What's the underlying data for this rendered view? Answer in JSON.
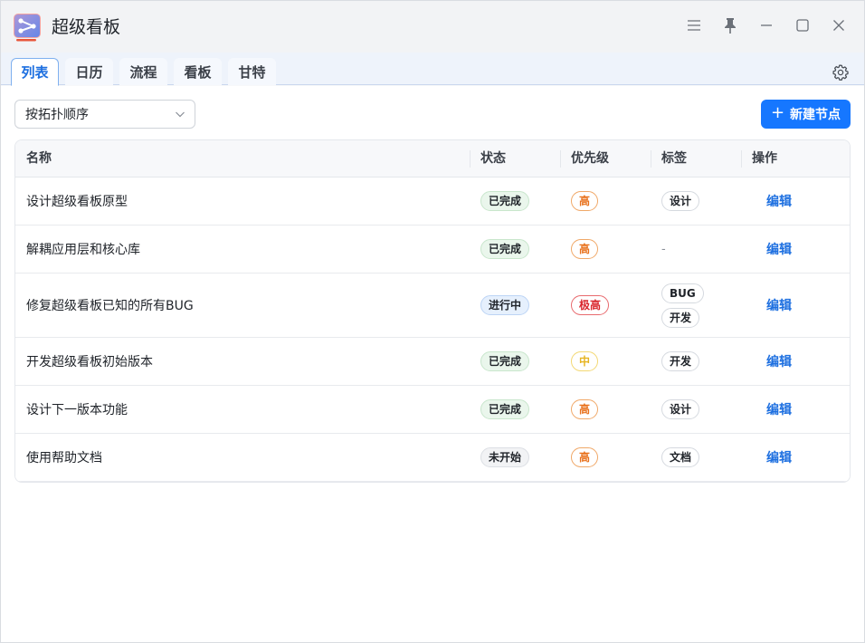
{
  "app": {
    "title": "超级看板"
  },
  "tabs": [
    {
      "label": "列表",
      "active": true
    },
    {
      "label": "日历",
      "active": false
    },
    {
      "label": "流程",
      "active": false
    },
    {
      "label": "看板",
      "active": false
    },
    {
      "label": "甘特",
      "active": false
    }
  ],
  "toolbar": {
    "sort_select_value": "按拓扑顺序",
    "new_button_label": "新建节点"
  },
  "table": {
    "headers": [
      "名称",
      "状态",
      "优先级",
      "标签",
      "操作"
    ],
    "rows": [
      {
        "name": "设计超级看板原型",
        "status": "已完成",
        "status_type": "done",
        "priority": "高",
        "priority_type": "high",
        "tags": [
          "设计"
        ],
        "action": "编辑"
      },
      {
        "name": "解耦应用层和核心库",
        "status": "已完成",
        "status_type": "done",
        "priority": "高",
        "priority_type": "high",
        "tags": [],
        "empty_tag": "-",
        "action": "编辑"
      },
      {
        "name": "修复超级看板已知的所有BUG",
        "status": "进行中",
        "status_type": "doing",
        "priority": "极高",
        "priority_type": "top",
        "tags": [
          "BUG",
          "开发"
        ],
        "action": "编辑"
      },
      {
        "name": "开发超级看板初始版本",
        "status": "已完成",
        "status_type": "done",
        "priority": "中",
        "priority_type": "mid",
        "tags": [
          "开发"
        ],
        "action": "编辑"
      },
      {
        "name": "设计下一版本功能",
        "status": "已完成",
        "status_type": "done",
        "priority": "高",
        "priority_type": "high",
        "tags": [
          "设计"
        ],
        "action": "编辑"
      },
      {
        "name": "使用帮助文档",
        "status": "未开始",
        "status_type": "todo",
        "priority": "高",
        "priority_type": "high",
        "tags": [
          "文档"
        ],
        "action": "编辑"
      }
    ]
  },
  "colors": {
    "accent": "#1677ff",
    "status_done_bg": "#eaf6ec",
    "status_doing_bg": "#e6f0fd",
    "priority_high": "#e8701a",
    "priority_top": "#d9262c",
    "priority_mid": "#e6b422"
  },
  "icons": {
    "logo": "share-board-logo",
    "menu": "hamburger-icon",
    "pin": "pin-icon",
    "minimize": "minimize-icon",
    "maximize": "maximize-icon",
    "close": "close-icon",
    "settings": "gear-icon",
    "select": "chevron-down-icon",
    "add": "plus-icon"
  }
}
